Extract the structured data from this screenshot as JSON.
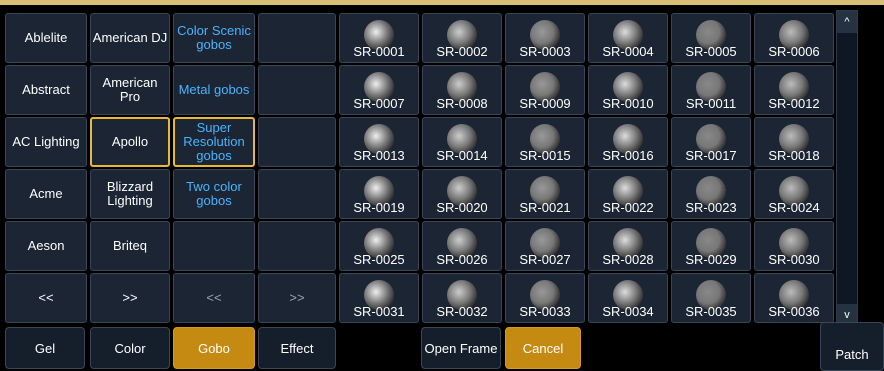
{
  "manufacturers": {
    "col1": [
      "Ablelite",
      "Abstract",
      "AC Lighting",
      "Acme",
      "Aeson",
      "<<"
    ],
    "col2": [
      "American DJ",
      "American Pro",
      "Apollo",
      "Blizzard Lighting",
      "Briteq",
      ">>"
    ]
  },
  "categories": [
    "Color Scenic gobos",
    "Metal gobos",
    "Super Resolution gobos",
    "Two color gobos",
    "",
    "<<"
  ],
  "extra_col": [
    "",
    "",
    "",
    "",
    "",
    ">>"
  ],
  "gobos": [
    "SR-0001",
    "SR-0002",
    "SR-0003",
    "SR-0004",
    "SR-0005",
    "SR-0006",
    "SR-0007",
    "SR-0008",
    "SR-0009",
    "SR-0010",
    "SR-0011",
    "SR-0012",
    "SR-0013",
    "SR-0014",
    "SR-0015",
    "SR-0016",
    "SR-0017",
    "SR-0018",
    "SR-0019",
    "SR-0020",
    "SR-0021",
    "SR-0022",
    "SR-0023",
    "SR-0024",
    "SR-0025",
    "SR-0026",
    "SR-0027",
    "SR-0028",
    "SR-0029",
    "SR-0030",
    "SR-0031",
    "SR-0032",
    "SR-0033",
    "SR-0034",
    "SR-0035",
    "SR-0036"
  ],
  "bottom": {
    "gel": "Gel",
    "color": "Color",
    "gobo": "Gobo",
    "effect": "Effect",
    "open_frame": "Open Frame",
    "cancel": "Cancel",
    "patch": "Patch"
  },
  "scrollbar": {
    "up": "^",
    "down": "v"
  },
  "colors": {
    "accent": "#e6b937",
    "button_bg": "#1b2533",
    "link_blue": "#4ab3ff",
    "orange": "#c58a12"
  }
}
